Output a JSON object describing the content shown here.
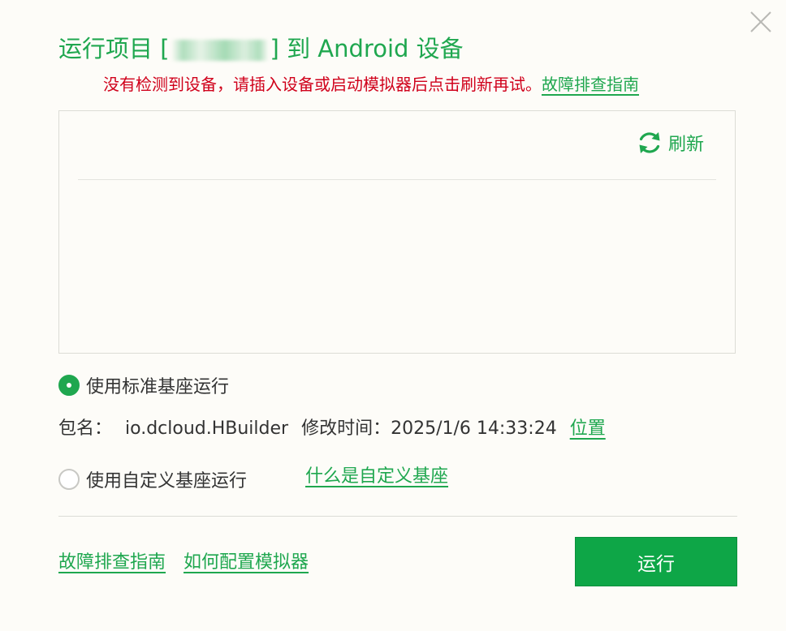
{
  "dialog": {
    "title_prefix": "运行项目 [",
    "title_suffix": "] 到 Android 设备",
    "warning": "没有检测到设备，请插入设备或启动模拟器后点击刷新再试。",
    "warning_link": "故障排查指南"
  },
  "device_panel": {
    "refresh_label": "刷新"
  },
  "base_options": {
    "standard_label": "使用标准基座运行",
    "standard_checked": true,
    "package_label": "包名：",
    "package_value": "io.dcloud.HBuilder",
    "modified_label": "修改时间：",
    "modified_value": "2025/1/6 14:33:24",
    "location_link": "位置",
    "custom_label": "使用自定义基座运行",
    "custom_checked": false,
    "custom_help_link": "什么是自定义基座"
  },
  "footer": {
    "troubleshoot_link": "故障排查指南",
    "emulator_link": "如何配置模拟器",
    "run_button": "运行"
  },
  "colors": {
    "accent": "#1fa74f",
    "warning": "#d0011b",
    "button": "#0ea647",
    "background": "#fdfcf8"
  }
}
